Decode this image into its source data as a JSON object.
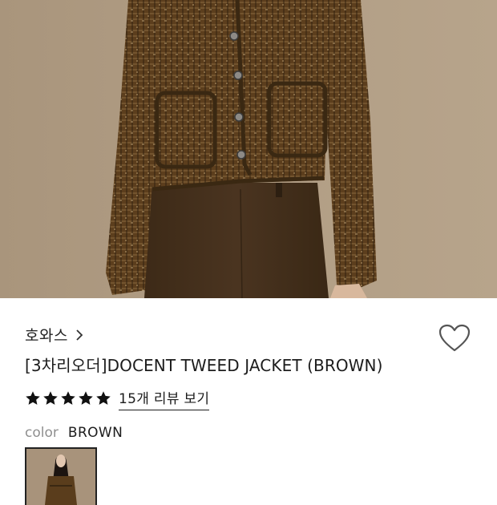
{
  "product": {
    "hero_image": "product-photo-model-wearing-brown-tweed-jacket",
    "brand": {
      "name": "호와스",
      "chevron_icon": "chevron-right-icon"
    },
    "title": "[3차리오더]DOCENT TWEED JACKET (BROWN)",
    "wishlist": {
      "icon": "heart-outline-icon",
      "active": false
    },
    "rating": {
      "stars": 5,
      "max": 5,
      "star_color": "#111111",
      "review_link": "15개 리뷰 보기"
    },
    "option": {
      "label": "color",
      "value": "BROWN"
    },
    "color_swatches": [
      {
        "name": "BROWN",
        "selected": true,
        "thumbnail": "model-brown-jacket-thumbnail"
      }
    ]
  },
  "colors": {
    "text": "#1c1c1c",
    "muted": "#8f8f8f",
    "jacket": "#5a3d1c",
    "backdrop": "#b09c83"
  }
}
